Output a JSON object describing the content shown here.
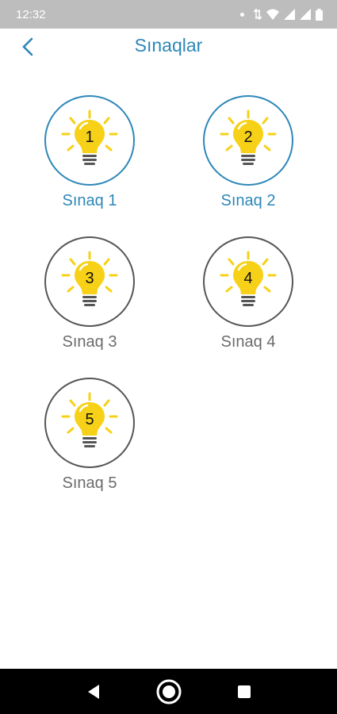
{
  "status_bar": {
    "time": "12:32"
  },
  "header": {
    "title": "Sınaqlar",
    "back_icon": "chevron-left-icon"
  },
  "colors": {
    "accent": "#2e87b8",
    "bulb": "#f7d117",
    "ring_inactive": "#555555"
  },
  "tests": [
    {
      "label": "Sınaq 1",
      "number": "1",
      "active": true
    },
    {
      "label": "Sınaq 2",
      "number": "2",
      "active": true
    },
    {
      "label": "Sınaq 3",
      "number": "3",
      "active": false
    },
    {
      "label": "Sınaq 4",
      "number": "4",
      "active": false
    },
    {
      "label": "Sınaq 5",
      "number": "5",
      "active": false
    }
  ],
  "nav": {
    "back_icon": "triangle-back-icon",
    "home_icon": "circle-home-icon",
    "recents_icon": "square-recents-icon"
  }
}
